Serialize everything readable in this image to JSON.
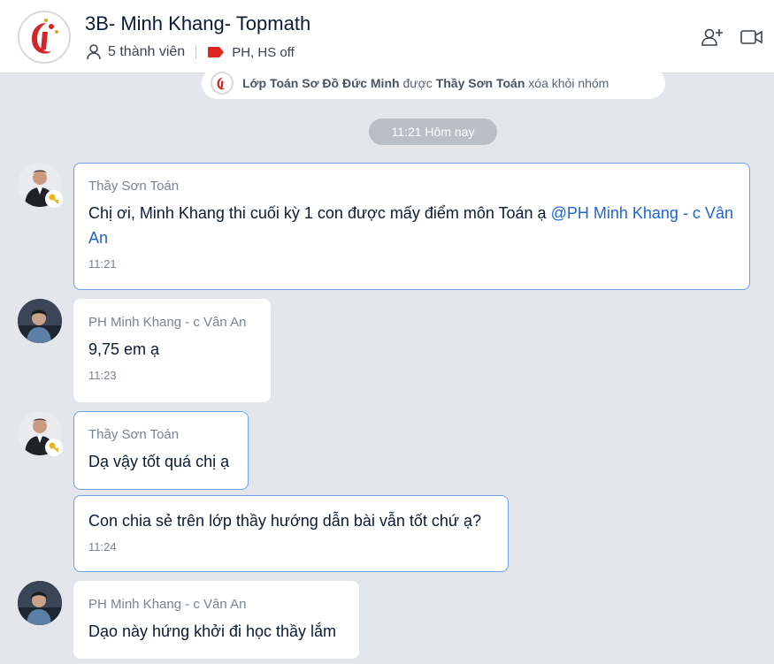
{
  "header": {
    "title": "3B- Minh Khang- Topmath",
    "members": "5 thành viên",
    "tag": "PH, HS off",
    "colors": {
      "tag": "#e02323",
      "accent": "#1e64d6"
    }
  },
  "notice": {
    "subject": "Lớp Toán Sơ Đồ Đức Minh",
    "verb": "được",
    "actor": "Thầy Sơn Toán",
    "action": "xóa khỏi nhóm"
  },
  "time_divider": "11:21 Hôm nay",
  "messages": [
    {
      "sender": "Thầy Sơn Toán",
      "text": "Chị ơi, Minh Khang thi cuối kỳ 1 con được mấy điểm môn Toán ạ",
      "mention": "@PH Minh Khang - c Vân An",
      "time": "11:21"
    },
    {
      "sender": "PH Minh Khang - c Vân An",
      "text": "9,75 em ạ",
      "time": "11:23"
    },
    {
      "sender": "Thầy Sơn Toán",
      "text": "Dạ vậy tốt quá chị ạ"
    },
    {
      "text": "Con chia sẻ trên lớp thầy hướng dẫn bài vẫn tốt chứ ạ?",
      "time": "11:24"
    },
    {
      "sender": "PH Minh Khang - c Vân An",
      "text": "Dạo này hứng khởi đi học thầy lắm"
    }
  ]
}
